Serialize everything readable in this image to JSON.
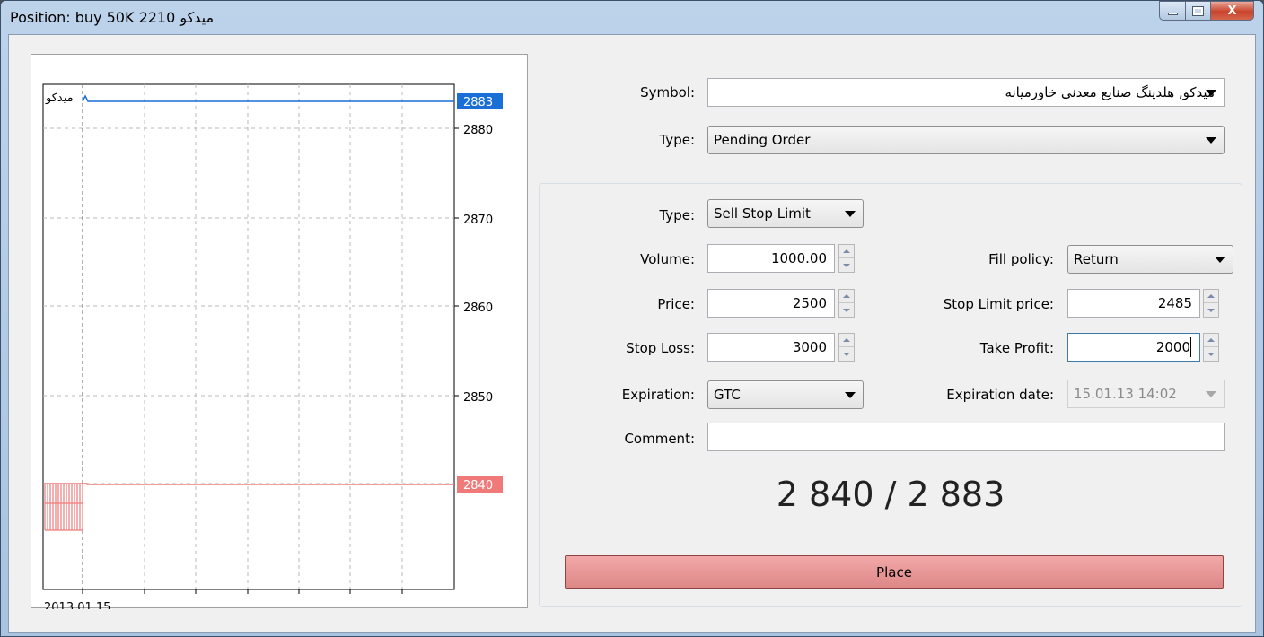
{
  "window": {
    "title": "Position: buy 50K 2210 میدکو",
    "close_glyph": "X"
  },
  "chart": {
    "symbol_label": "میدکو",
    "y_ticks": [
      "2880",
      "2870",
      "2860",
      "2850"
    ],
    "ask_badge": "2883",
    "bid_badge": "2840",
    "x_label": "2013.01.15",
    "ask_color": "#1a6fd6",
    "bid_color": "#f07a7a"
  },
  "form": {
    "symbol_label": "Symbol:",
    "symbol_value": "میدکو, هلدینگ صنایع معدنی خاورمیانه",
    "type_label": "Type:",
    "type_value": "Pending Order",
    "order_type_label": "Type:",
    "order_type_value": "Sell Stop Limit",
    "volume_label": "Volume:",
    "volume_value": "1000.00",
    "fill_policy_label": "Fill policy:",
    "fill_policy_value": "Return",
    "price_label": "Price:",
    "price_value": "2500",
    "stop_limit_label": "Stop Limit price:",
    "stop_limit_value": "2485",
    "stop_loss_label": "Stop Loss:",
    "stop_loss_value": "3000",
    "take_profit_label": "Take Profit:",
    "take_profit_value": "2000",
    "expiration_label": "Expiration:",
    "expiration_value": "GTC",
    "expiration_date_label": "Expiration date:",
    "expiration_date_value": "15.01.13 14:02",
    "comment_label": "Comment:",
    "comment_value": "",
    "quote": "2 840 / 2 883",
    "place_label": "Place"
  }
}
